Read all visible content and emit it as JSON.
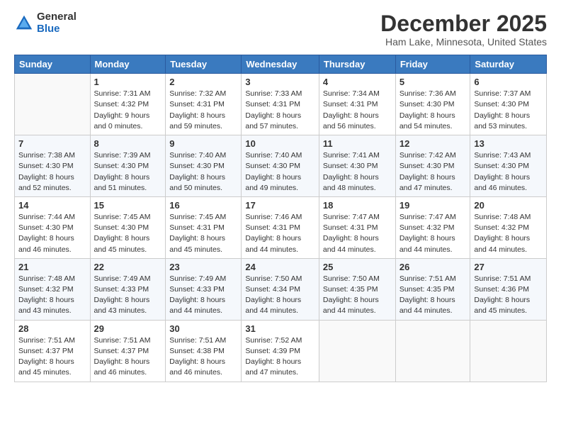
{
  "logo": {
    "general": "General",
    "blue": "Blue"
  },
  "title": "December 2025",
  "subtitle": "Ham Lake, Minnesota, United States",
  "headers": [
    "Sunday",
    "Monday",
    "Tuesday",
    "Wednesday",
    "Thursday",
    "Friday",
    "Saturday"
  ],
  "weeks": [
    [
      {
        "day": "",
        "info": ""
      },
      {
        "day": "1",
        "info": "Sunrise: 7:31 AM\nSunset: 4:32 PM\nDaylight: 9 hours\nand 0 minutes."
      },
      {
        "day": "2",
        "info": "Sunrise: 7:32 AM\nSunset: 4:31 PM\nDaylight: 8 hours\nand 59 minutes."
      },
      {
        "day": "3",
        "info": "Sunrise: 7:33 AM\nSunset: 4:31 PM\nDaylight: 8 hours\nand 57 minutes."
      },
      {
        "day": "4",
        "info": "Sunrise: 7:34 AM\nSunset: 4:31 PM\nDaylight: 8 hours\nand 56 minutes."
      },
      {
        "day": "5",
        "info": "Sunrise: 7:36 AM\nSunset: 4:30 PM\nDaylight: 8 hours\nand 54 minutes."
      },
      {
        "day": "6",
        "info": "Sunrise: 7:37 AM\nSunset: 4:30 PM\nDaylight: 8 hours\nand 53 minutes."
      }
    ],
    [
      {
        "day": "7",
        "info": "Sunrise: 7:38 AM\nSunset: 4:30 PM\nDaylight: 8 hours\nand 52 minutes."
      },
      {
        "day": "8",
        "info": "Sunrise: 7:39 AM\nSunset: 4:30 PM\nDaylight: 8 hours\nand 51 minutes."
      },
      {
        "day": "9",
        "info": "Sunrise: 7:40 AM\nSunset: 4:30 PM\nDaylight: 8 hours\nand 50 minutes."
      },
      {
        "day": "10",
        "info": "Sunrise: 7:40 AM\nSunset: 4:30 PM\nDaylight: 8 hours\nand 49 minutes."
      },
      {
        "day": "11",
        "info": "Sunrise: 7:41 AM\nSunset: 4:30 PM\nDaylight: 8 hours\nand 48 minutes."
      },
      {
        "day": "12",
        "info": "Sunrise: 7:42 AM\nSunset: 4:30 PM\nDaylight: 8 hours\nand 47 minutes."
      },
      {
        "day": "13",
        "info": "Sunrise: 7:43 AM\nSunset: 4:30 PM\nDaylight: 8 hours\nand 46 minutes."
      }
    ],
    [
      {
        "day": "14",
        "info": "Sunrise: 7:44 AM\nSunset: 4:30 PM\nDaylight: 8 hours\nand 46 minutes."
      },
      {
        "day": "15",
        "info": "Sunrise: 7:45 AM\nSunset: 4:30 PM\nDaylight: 8 hours\nand 45 minutes."
      },
      {
        "day": "16",
        "info": "Sunrise: 7:45 AM\nSunset: 4:31 PM\nDaylight: 8 hours\nand 45 minutes."
      },
      {
        "day": "17",
        "info": "Sunrise: 7:46 AM\nSunset: 4:31 PM\nDaylight: 8 hours\nand 44 minutes."
      },
      {
        "day": "18",
        "info": "Sunrise: 7:47 AM\nSunset: 4:31 PM\nDaylight: 8 hours\nand 44 minutes."
      },
      {
        "day": "19",
        "info": "Sunrise: 7:47 AM\nSunset: 4:32 PM\nDaylight: 8 hours\nand 44 minutes."
      },
      {
        "day": "20",
        "info": "Sunrise: 7:48 AM\nSunset: 4:32 PM\nDaylight: 8 hours\nand 44 minutes."
      }
    ],
    [
      {
        "day": "21",
        "info": "Sunrise: 7:48 AM\nSunset: 4:32 PM\nDaylight: 8 hours\nand 43 minutes."
      },
      {
        "day": "22",
        "info": "Sunrise: 7:49 AM\nSunset: 4:33 PM\nDaylight: 8 hours\nand 43 minutes."
      },
      {
        "day": "23",
        "info": "Sunrise: 7:49 AM\nSunset: 4:33 PM\nDaylight: 8 hours\nand 44 minutes."
      },
      {
        "day": "24",
        "info": "Sunrise: 7:50 AM\nSunset: 4:34 PM\nDaylight: 8 hours\nand 44 minutes."
      },
      {
        "day": "25",
        "info": "Sunrise: 7:50 AM\nSunset: 4:35 PM\nDaylight: 8 hours\nand 44 minutes."
      },
      {
        "day": "26",
        "info": "Sunrise: 7:51 AM\nSunset: 4:35 PM\nDaylight: 8 hours\nand 44 minutes."
      },
      {
        "day": "27",
        "info": "Sunrise: 7:51 AM\nSunset: 4:36 PM\nDaylight: 8 hours\nand 45 minutes."
      }
    ],
    [
      {
        "day": "28",
        "info": "Sunrise: 7:51 AM\nSunset: 4:37 PM\nDaylight: 8 hours\nand 45 minutes."
      },
      {
        "day": "29",
        "info": "Sunrise: 7:51 AM\nSunset: 4:37 PM\nDaylight: 8 hours\nand 46 minutes."
      },
      {
        "day": "30",
        "info": "Sunrise: 7:51 AM\nSunset: 4:38 PM\nDaylight: 8 hours\nand 46 minutes."
      },
      {
        "day": "31",
        "info": "Sunrise: 7:52 AM\nSunset: 4:39 PM\nDaylight: 8 hours\nand 47 minutes."
      },
      {
        "day": "",
        "info": ""
      },
      {
        "day": "",
        "info": ""
      },
      {
        "day": "",
        "info": ""
      }
    ]
  ]
}
